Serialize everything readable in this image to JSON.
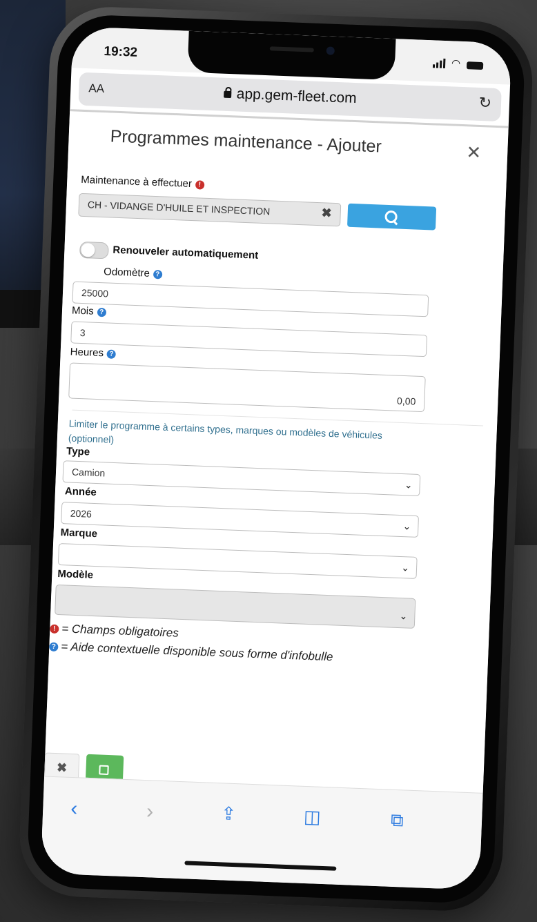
{
  "status": {
    "time": "19:32"
  },
  "browser": {
    "text_size_label": "AA",
    "url": "app.gem-fleet.com"
  },
  "modal": {
    "title": "Programmes maintenance - Ajouter",
    "maintenance": {
      "label": "Maintenance à effectuer",
      "value": "CH - VIDANGE D'HUILE ET INSPECTION"
    },
    "auto_renew_label": "Renouveler automatiquement",
    "odometer": {
      "label": "Odomètre",
      "value": "25000"
    },
    "months": {
      "label": "Mois",
      "value": "3"
    },
    "hours": {
      "label": "Heures",
      "value": "0,00"
    },
    "limit_text": "Limiter le programme à certains types, marques ou modèles de véhicules (optionnel)",
    "type": {
      "label": "Type",
      "value": "Camion"
    },
    "year": {
      "label": "Année",
      "value": "2026"
    },
    "brand": {
      "label": "Marque",
      "value": ""
    },
    "model": {
      "label": "Modèle",
      "value": ""
    },
    "legend_required": "= Champs obligatoires",
    "legend_help": "= Aide contextuelle disponible sous forme d'infobulle"
  },
  "icons": {
    "required": "exclamation-circle-icon",
    "help": "question-circle-icon",
    "search": "search-icon",
    "clear": "clear-icon",
    "save": "floppy-disk-icon",
    "toolbar": [
      "back-icon",
      "forward-icon",
      "share-icon",
      "bookmarks-icon",
      "tabs-icon"
    ]
  },
  "colors": {
    "search_button": "#3aa3e0",
    "save_button": "#5cb85c",
    "required": "#c9302c",
    "help": "#2f7dd0",
    "link_text": "#31708f",
    "toolbar_icons": "#2b7ae0"
  }
}
